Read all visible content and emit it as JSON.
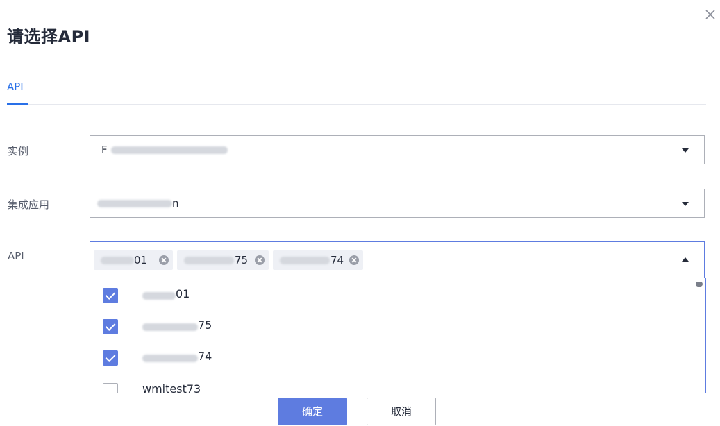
{
  "dialog": {
    "title": "请选择API",
    "close_icon": "close-icon"
  },
  "tabs": [
    {
      "label": "API",
      "active": true
    }
  ],
  "form": {
    "instance": {
      "label": "实例",
      "value_visible": "F",
      "value_visible_suffix": ""
    },
    "integration_app": {
      "label": "集成应用",
      "value_visible_suffix": "n"
    },
    "api": {
      "label": "API",
      "selected_tags": [
        {
          "visible_suffix": "01"
        },
        {
          "visible_suffix": "75"
        },
        {
          "visible_suffix": "74"
        }
      ]
    }
  },
  "dropdown": {
    "options": [
      {
        "checked": true,
        "visible_text": "01",
        "label": ""
      },
      {
        "checked": true,
        "visible_text": "75",
        "label": ""
      },
      {
        "checked": true,
        "visible_text": "74",
        "label": ""
      },
      {
        "checked": false,
        "visible_text": "",
        "label": "wmjtest73"
      }
    ]
  },
  "footer": {
    "confirm_label": "确定",
    "cancel_label": "取消"
  },
  "colors": {
    "accent": "#5e7ce0",
    "tab_active": "#2970e8",
    "text": "#252b3a",
    "label": "#575d6c",
    "border": "#adb0b8"
  }
}
